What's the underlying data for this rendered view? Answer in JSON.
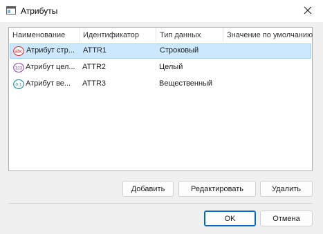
{
  "window": {
    "title": "Атрибуты"
  },
  "icons": {
    "app": "window-app-icon",
    "close": "close-icon",
    "string_type": "string-type-icon",
    "integer_type": "integer-type-icon",
    "float_type": "float-type-icon"
  },
  "list": {
    "columns": [
      {
        "label": "Наименование"
      },
      {
        "label": "Идентификатор"
      },
      {
        "label": "Тип данных"
      },
      {
        "label": "Значение по умолчанию"
      }
    ],
    "rows": [
      {
        "icon_text": "abc",
        "name": "Атрибут стр...",
        "id": "ATTR1",
        "type": "Строковый",
        "default": "",
        "selected": true
      },
      {
        "icon_text": "123",
        "name": "Атрибут цел...",
        "id": "ATTR2",
        "type": "Целый",
        "default": "",
        "selected": false
      },
      {
        "icon_text": "0.1",
        "name": "Атрибут ве...",
        "id": "ATTR3",
        "type": "Вещественный",
        "default": "",
        "selected": false
      }
    ]
  },
  "actions": {
    "add": "Добавить",
    "edit": "Редактировать",
    "delete": "Удалить"
  },
  "dialog_buttons": {
    "ok": "OK",
    "cancel": "Отмена"
  },
  "colors": {
    "selection": "#cce8ff",
    "selection_border": "#99d1ff",
    "default_button_border": "#0067c0",
    "icon_red": "#d9302c",
    "icon_purple": "#8a4fa8",
    "icon_teal": "#1a8a9a"
  }
}
